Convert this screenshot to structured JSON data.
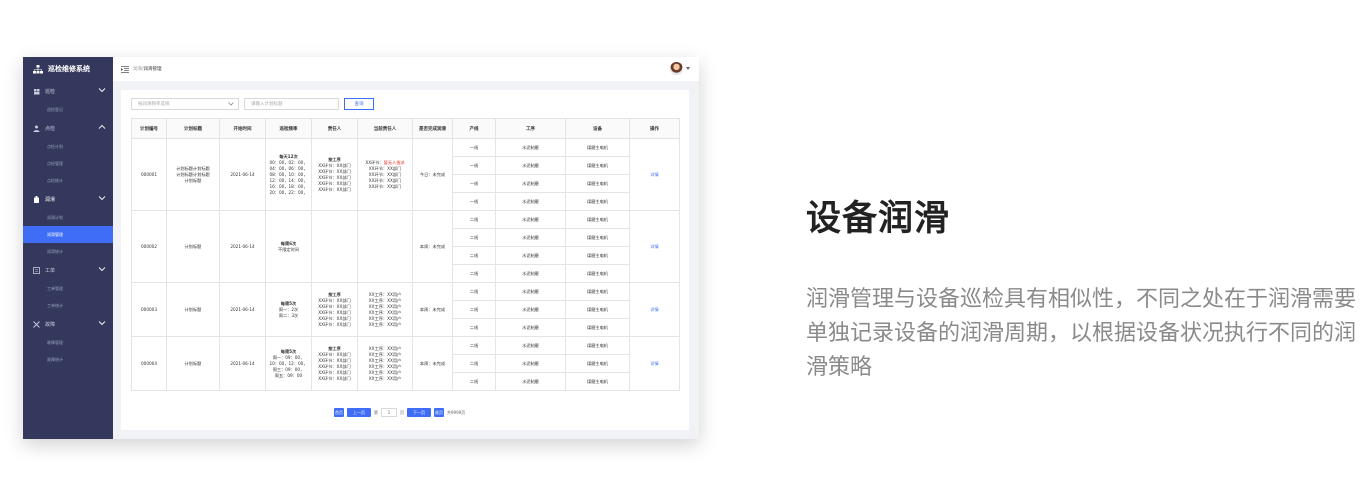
{
  "app": {
    "title": "巡检维修系统"
  },
  "sidebar": {
    "groups": [
      {
        "label": "巡检",
        "icon": "inspection-icon",
        "open": true,
        "items": [
          {
            "label": "巡检登记",
            "active": false
          }
        ]
      },
      {
        "label": "点检",
        "icon": "spot-check-icon",
        "open": true,
        "items": [
          {
            "label": "点检计划",
            "active": false
          },
          {
            "label": "点检管理",
            "active": false
          },
          {
            "label": "点检统计",
            "active": false
          }
        ]
      },
      {
        "label": "润滑",
        "icon": "oil-icon",
        "open": true,
        "items": [
          {
            "label": "润滑计划",
            "active": false
          },
          {
            "label": "润滑管理",
            "active": true
          },
          {
            "label": "润滑统计",
            "active": false
          }
        ]
      },
      {
        "label": "工单",
        "icon": "work-order-icon",
        "open": true,
        "items": [
          {
            "label": "工单管理",
            "active": false
          },
          {
            "label": "工单统计",
            "active": false
          }
        ]
      },
      {
        "label": "故障",
        "icon": "fault-icon",
        "open": true,
        "items": [
          {
            "label": "故障管理",
            "active": false
          },
          {
            "label": "故障统计",
            "active": false
          }
        ]
      }
    ]
  },
  "breadcrumb": {
    "parent": "润滑",
    "sep": "/",
    "current": "润滑管理"
  },
  "filters": {
    "select_placeholder": "按润滑频率选择",
    "input_placeholder": "请输入计划标题",
    "query_label": "查询"
  },
  "table": {
    "headers": [
      "计划编号",
      "计划标题",
      "开始时间",
      "巡检频率",
      "责任人",
      "当前责任人",
      "是否完成润滑",
      "产线",
      "工序",
      "设备",
      "操作"
    ],
    "groups": [
      {
        "id": "000001",
        "title": "计划标题计划标题\n计划标题计划标题\n计划标题",
        "start": "2021-06-14",
        "freq_head": "每天12次",
        "freq_body": "00：00，02：00，\n04：00，06：00，\n08：00，10：00，\n12：00，14：00，\n16：00，18：00，\n20：00，22：00，",
        "owner_head": "按工序",
        "owner_body": "XX环节：XX部门\nXX环节：XX部门\nXX环节：XX部门\nXX环节：XX部门\nXX环节：XX部门",
        "current_red_prefix": "XX环节：",
        "current_red": "暂无人指派",
        "current_body": "XX环节：XX部门\nXX环节：XX部门\nXX环节：XX部门\nXX环节：XX部门",
        "done": "今日：未完成",
        "rows": [
          {
            "line": "一线",
            "process": "水泥制磨",
            "device": "煤磨主电机"
          },
          {
            "line": "一线",
            "process": "水泥制磨",
            "device": "煤磨主电机"
          },
          {
            "line": "一线",
            "process": "水泥制磨",
            "device": "煤磨主电机"
          },
          {
            "line": "一线",
            "process": "水泥制磨",
            "device": "煤磨主电机"
          }
        ],
        "action": "详情"
      },
      {
        "id": "000002",
        "title": "计划标题",
        "start": "2021-06-14",
        "freq_head": "每周6次",
        "freq_body": "不限定时间",
        "owner_head": "",
        "owner_body": "",
        "current_red_prefix": "",
        "current_red": "",
        "current_body": "",
        "done": "本周：未完成",
        "rows": [
          {
            "line": "二线",
            "process": "水泥制磨",
            "device": "煤磨主电机"
          },
          {
            "line": "二线",
            "process": "水泥制磨",
            "device": "煤磨主电机"
          },
          {
            "line": "二线",
            "process": "水泥制磨",
            "device": "煤磨主电机"
          },
          {
            "line": "二线",
            "process": "水泥制磨",
            "device": "煤磨主电机"
          }
        ],
        "action": "详情"
      },
      {
        "id": "000003",
        "title": "计划标题",
        "start": "2021-06-14",
        "freq_head": "每周5次",
        "freq_body": "周一：2次\n周二：3次",
        "owner_head": "按工序",
        "owner_body": "XX环节：XX部门\nXX环节：XX部门\nXX环节：XX部门\nXX环节：XX部门\nXX环节：XX部门",
        "current_red_prefix": "",
        "current_red": "",
        "current_body": "XX工序：XX用户\nXX工序：XX用户\nXX工序：XX用户\nXX工序：XX用户\nXX工序：XX用户\nXX工序：XX用户",
        "done": "本周：未完成",
        "rows": [
          {
            "line": "二线",
            "process": "水泥制磨",
            "device": "煤磨主电机"
          },
          {
            "line": "二线",
            "process": "水泥制磨",
            "device": "煤磨主电机"
          },
          {
            "line": "二线",
            "process": "水泥制磨",
            "device": "煤磨主电机"
          }
        ],
        "action": "详情"
      },
      {
        "id": "000004",
        "title": "计划标题",
        "start": "2021-06-14",
        "freq_head": "每周5次",
        "freq_body": "周一：09：00，\n10：00，12：00，\n周三：09：00，\n周五：09：00",
        "owner_head": "按工序",
        "owner_body": "XX环节：XX部门\nXX环节：XX部门\nXX环节：XX部门\nXX环节：XX部门\nXX环节：XX部门",
        "current_red_prefix": "",
        "current_red": "",
        "current_body": "XX工序：XX用户\nXX工序：XX用户\nXX工序：XX用户\nXX工序：XX用户\nXX工序：XX用户\nXX工序：XX用户",
        "done": "本周：未完成",
        "rows": [
          {
            "line": "二线",
            "process": "水泥制磨",
            "device": "煤磨主电机"
          },
          {
            "line": "二线",
            "process": "水泥制磨",
            "device": "煤磨主电机"
          },
          {
            "line": "二线",
            "process": "水泥制磨",
            "device": "煤磨主电机"
          }
        ],
        "action": "详情"
      }
    ]
  },
  "pager": {
    "first": "首页",
    "prev": "上一页",
    "page_prefix": "第",
    "page_value": "1",
    "page_suffix": "页",
    "next": "下一页",
    "last": "尾页",
    "total": "共9999页"
  },
  "feature": {
    "title": "设备润滑",
    "desc": "润滑管理与设备巡检具有相似性，不同之处在于润滑需要单独记录设备的润滑周期，以根据设备状况执行不同的润滑策略"
  },
  "colors": {
    "sidebar": "#33385c",
    "accent": "#3f6df5",
    "alert": "#e8312a"
  }
}
